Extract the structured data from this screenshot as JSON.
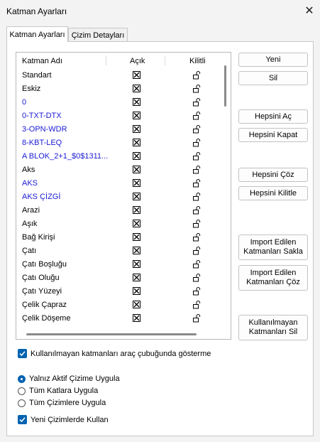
{
  "window": {
    "title": "Katman Ayarları"
  },
  "tabs": [
    {
      "label": "Katman Ayarları",
      "active": true
    },
    {
      "label": "Çizim Detayları",
      "active": false
    }
  ],
  "list": {
    "columns": {
      "name": "Katman Adı",
      "visible": "Açık",
      "locked": "Kilitli"
    },
    "rows": [
      {
        "name": "Standart",
        "color": "#000000"
      },
      {
        "name": "Eskiz",
        "color": "#000000"
      },
      {
        "name": "0",
        "color": "#1a1ad6"
      },
      {
        "name": "0-TXT-DTX",
        "color": "#1a1ad6"
      },
      {
        "name": "3-OPN-WDR",
        "color": "#1a1ad6"
      },
      {
        "name": "8-KBT-LEQ",
        "color": "#1a1ad6"
      },
      {
        "name": "A BLOK_2+1_$0$1311...",
        "color": "#1a1ad6"
      },
      {
        "name": "Aks",
        "color": "#000000"
      },
      {
        "name": "AKS",
        "color": "#1a1ad6"
      },
      {
        "name": "AKS ÇİZGİ",
        "color": "#1a1ad6"
      },
      {
        "name": "Arazi",
        "color": "#000000"
      },
      {
        "name": "Aşık",
        "color": "#000000"
      },
      {
        "name": "Bağ Kirişi",
        "color": "#000000"
      },
      {
        "name": "Çatı",
        "color": "#000000"
      },
      {
        "name": "Çatı Boşluğu",
        "color": "#000000"
      },
      {
        "name": "Çatı Oluğu",
        "color": "#000000"
      },
      {
        "name": "Çatı Yüzeyi",
        "color": "#000000"
      },
      {
        "name": "Çelik Çapraz",
        "color": "#000000"
      },
      {
        "name": "Çelik Döşeme",
        "color": "#000000"
      }
    ]
  },
  "buttons": {
    "new": "Yeni",
    "delete": "Sil",
    "show_all": "Hepsini Aç",
    "hide_all": "Hepsini Kapat",
    "unlock_all": "Hepsini Çöz",
    "lock_all": "Hepsini Kilitle",
    "hide_imported": "Import Edilen\nKatmanları Sakla",
    "unlock_imported": "Import Edilen\nKatmanları Çöz",
    "delete_unused": "Kullanılmayan\nKatmanları Sil"
  },
  "options": {
    "hide_unused": {
      "label": "Kullanılmayan katmanları araç çubuğunda gösterme",
      "checked": true
    },
    "scope": [
      {
        "label": "Yalnız Aktif Çizime Uygula",
        "selected": true
      },
      {
        "label": "Tüm Katlara Uygula",
        "selected": false
      },
      {
        "label": "Tüm Çizimlere Uygula",
        "selected": false
      }
    ],
    "use_in_new": {
      "label": "Yeni Çizimlerde Kullan",
      "checked": true
    }
  },
  "colors": {
    "accent": "#0063b1",
    "blue_layer": "#1a1ad6"
  }
}
